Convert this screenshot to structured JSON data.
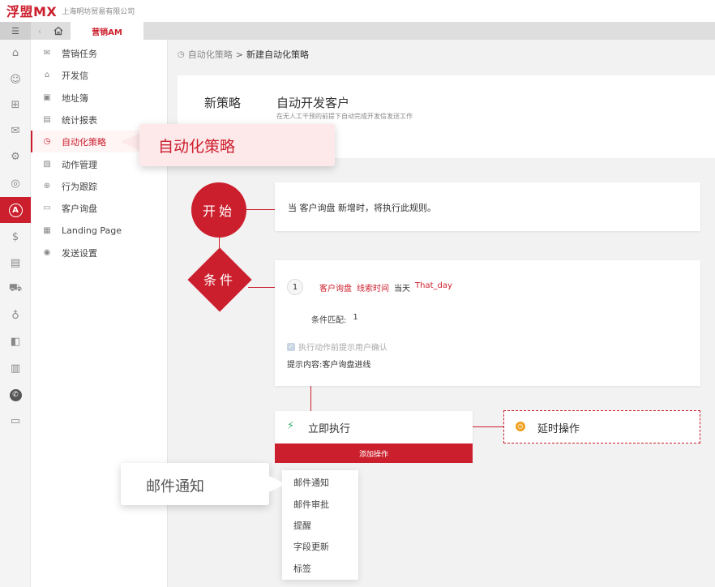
{
  "header": {
    "logo": "浮盟MX",
    "company": "上海明坊贸易有限公司"
  },
  "tabs": {
    "active": "营销AM"
  },
  "rail_icons": [
    "home-icon",
    "contact-icon",
    "org-icon",
    "mail-icon",
    "settings-cog-icon",
    "compass-icon",
    "automation-icon",
    "dollar-icon",
    "document-icon",
    "truck-icon",
    "money-bag-icon",
    "book-icon",
    "chart-icon",
    "chat-icon",
    "monitor-icon"
  ],
  "menu": {
    "items": [
      {
        "label": "营销任务"
      },
      {
        "label": "开发信"
      },
      {
        "label": "地址簿"
      },
      {
        "label": "统计报表"
      },
      {
        "label": "自动化策略"
      },
      {
        "label": "动作管理"
      },
      {
        "label": "行为跟踪"
      },
      {
        "label": "客户询盘"
      },
      {
        "label": "Landing Page"
      },
      {
        "label": "发送设置"
      }
    ]
  },
  "breadcrumb": {
    "parent": "自动化策略",
    "current": "新建自动化策略"
  },
  "strategy": {
    "label": "新策略",
    "name": "自动开发客户",
    "desc": "在无人工干预的前提下自动完成开发信发送工作"
  },
  "start_node": {
    "label": "开始",
    "text": "当 客户询盘 新增时，将执行此规则。"
  },
  "condition_node": {
    "label": "条件",
    "index": "1",
    "field1": "客户询盘",
    "field2": "线索时间",
    "op": "当天",
    "value": "That_day",
    "match_label": "条件匹配:",
    "match_value": "1",
    "confirm_label": "执行动作前提示用户确认",
    "hint": "提示内容:客户询盘进线"
  },
  "action": {
    "label": "立即执行",
    "add_button": "添加操作",
    "delay_label": "延时操作"
  },
  "dropdown": {
    "items": [
      "邮件通知",
      "邮件审批",
      "提醒",
      "字段更新",
      "标签"
    ]
  },
  "callouts": {
    "menu": "自动化策略",
    "dropdown": "邮件通知"
  },
  "colors": {
    "accent": "#cc1f2d",
    "delay_icon": "#f0a020",
    "bolt": "#3cb371"
  }
}
